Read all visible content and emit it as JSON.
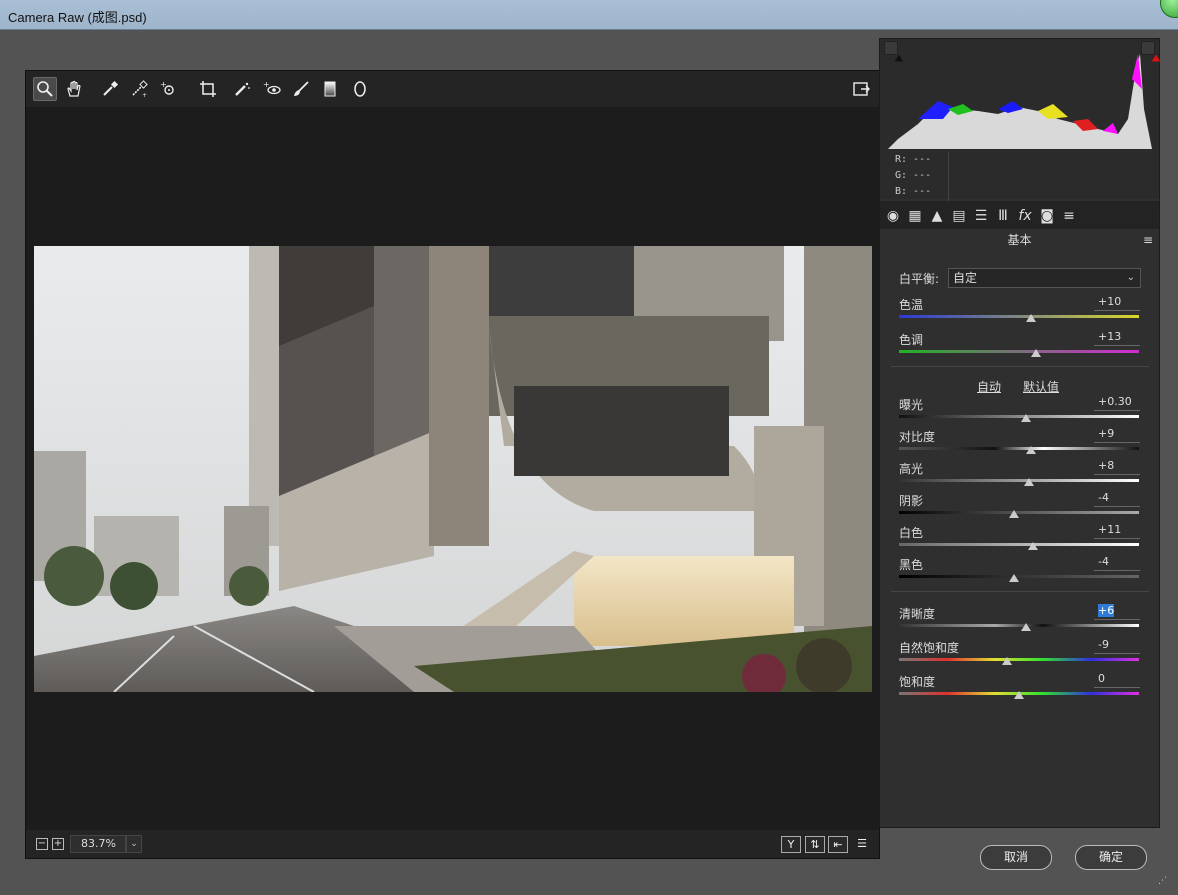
{
  "window": {
    "title": "Camera Raw (成图.psd)"
  },
  "toolbar": {
    "tools": [
      "zoom-tool",
      "hand-tool",
      "white-balance-tool",
      "color-sampler-tool",
      "targeted-adjustment-tool",
      "crop-tool",
      "spot-removal-tool",
      "red-eye-tool",
      "adjustment-brush-tool",
      "graduated-filter-tool",
      "radial-filter-tool"
    ],
    "active_tool": "zoom-tool",
    "open_preferences": "open-in-photoshop-icon"
  },
  "zoom": {
    "value": "83.7%",
    "minus": "−",
    "plus": "+"
  },
  "histogram": {
    "r": "R:  ---",
    "g": "G:  ---",
    "b": "B:  ---"
  },
  "panel": {
    "title": "基本",
    "white_balance": {
      "label": "白平衡:",
      "value": "自定"
    },
    "sliders_wb": [
      {
        "label": "色温",
        "value": "+10",
        "pos": 0.55
      },
      {
        "label": "色调",
        "value": "+13",
        "pos": 0.57
      }
    ],
    "auto_label": "自动",
    "default_label": "默认值",
    "sliders_tone": [
      {
        "label": "曝光",
        "value": "+0.30",
        "pos": 0.53
      },
      {
        "label": "对比度",
        "value": "+9",
        "pos": 0.55
      },
      {
        "label": "高光",
        "value": "+8",
        "pos": 0.54
      },
      {
        "label": "阴影",
        "value": "-4",
        "pos": 0.48
      },
      {
        "label": "白色",
        "value": "+11",
        "pos": 0.56
      },
      {
        "label": "黑色",
        "value": "-4",
        "pos": 0.48
      }
    ],
    "sliders_presence": [
      {
        "label": "清晰度",
        "value": "+6",
        "pos": 0.53,
        "selected": true
      },
      {
        "label": "自然饱和度",
        "value": "-9",
        "pos": 0.45
      },
      {
        "label": "饱和度",
        "value": "0",
        "pos": 0.5
      }
    ]
  },
  "buttons": {
    "cancel": "取消",
    "ok": "确定"
  },
  "colors": {
    "panel_bg": "#2f2f2f",
    "canvas_bg": "#1c1c1c",
    "selection": "#2f7ad6"
  }
}
